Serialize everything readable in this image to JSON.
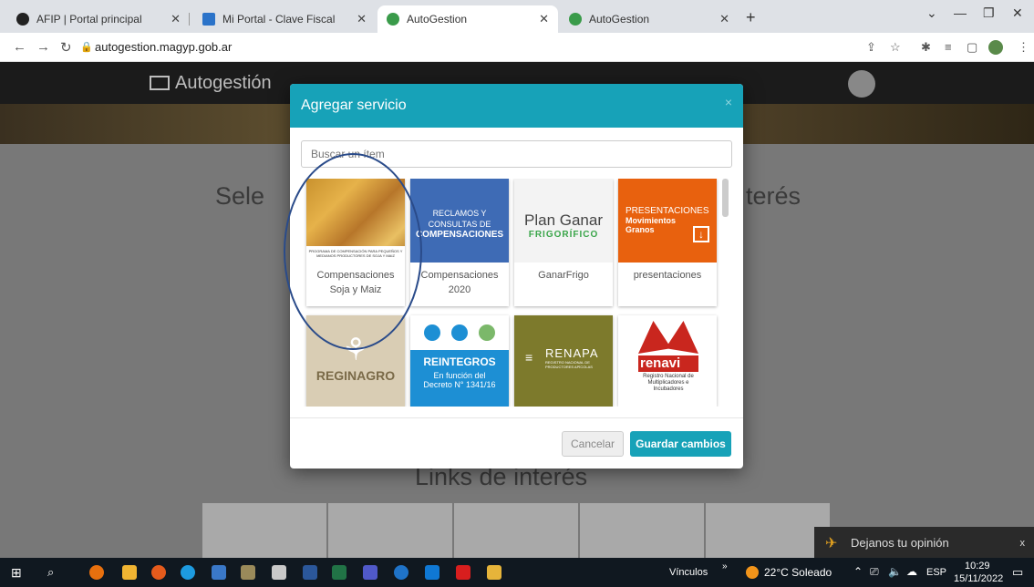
{
  "browser": {
    "tabs": [
      {
        "label": "AFIP | Portal principal"
      },
      {
        "label": "Mi Portal - Clave Fiscal"
      },
      {
        "label": "AutoGestion"
      },
      {
        "label": "AutoGestion"
      }
    ],
    "url": "autogestion.magyp.gob.ar"
  },
  "page": {
    "brand": "Autogestión",
    "bg_title_left": "Sele",
    "bg_title_right": "terés",
    "links_title": "Links de interés",
    "opinion_label": "Dejanos tu opinión",
    "opinion_close": "x"
  },
  "modal": {
    "title": "Agregar servicio",
    "close": "×",
    "search_placeholder": "Buscar un ítem",
    "cards": [
      {
        "caption": "Compensaciones Soja y Maiz",
        "image_text": "PROGRAMA DE COMPENSACIÓN PARA PEQUEÑOS Y MEDIANOS PRODUCTORES DE SOJA Y MAIZ"
      },
      {
        "caption": "Compensaciones 2020",
        "image_line1": "RECLAMOS Y",
        "image_line2": "CONSULTAS DE",
        "image_line3": "COMPENSACIONES"
      },
      {
        "caption": "GanarFrigo",
        "image_line1": "Plan Ganar",
        "image_line2": "FRIGORÍFICO"
      },
      {
        "caption": "presentaciones",
        "image_line1": "PRESENTACIONES",
        "image_line2": "Movimientos",
        "image_line3": "Granos"
      },
      {
        "caption": "",
        "image_line1": "REGINAGRO"
      },
      {
        "caption": "",
        "image_line1": "REINTEGROS",
        "image_line2": "En función del",
        "image_line3": "Decreto N° 1341/16"
      },
      {
        "caption": "",
        "image_line1": "RENAPA",
        "image_line2": "REGISTRO NACIONAL DE PRODUCTORES APÍCOLAS"
      },
      {
        "caption": "",
        "image_line1": "renavi",
        "image_line2": "Registro Nacional de Multiplicadores e Incubadores"
      }
    ],
    "cancel_label": "Cancelar",
    "save_label": "Guardar cambios"
  },
  "taskbar": {
    "vinculos": "Vínculos",
    "weather": "22°C Soleado",
    "lang": "ESP",
    "time": "10:29",
    "date": "15/11/2022"
  },
  "colors": {
    "accent": "#17a2b8",
    "compensaciones_blue": "#3e6bb5",
    "presentaciones_orange": "#e8610e",
    "renapa_olive": "#7d7a2c",
    "reintegros_blue": "#1d8fd4"
  }
}
